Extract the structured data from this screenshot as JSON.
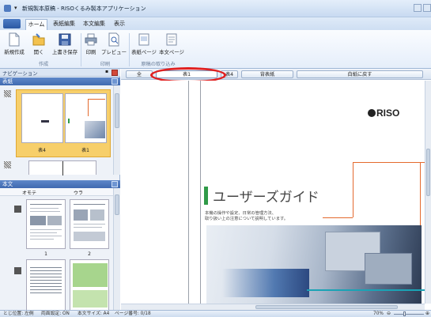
{
  "window": {
    "title": "新規製本原稿 - RISOくるみ製本アプリケーション"
  },
  "tabs": [
    "ホーム",
    "表紙編集",
    "本文編集",
    "表示"
  ],
  "ribbon": {
    "buttons": [
      "新規作成",
      "開く",
      "上書き保存",
      "印刷",
      "プレビュー",
      "表紙ページ",
      "本文ページ"
    ],
    "groups": [
      "作成",
      "印刷",
      "原稿の取り込み"
    ]
  },
  "nav": {
    "header": "ナビゲーション",
    "cover": {
      "header": "表紙",
      "thumb_labels": [
        "表4",
        "表1"
      ]
    },
    "body": {
      "header": "本文",
      "columns": [
        "オモテ",
        "ウラ"
      ],
      "page_numbers": [
        "1",
        "2"
      ]
    }
  },
  "doctabs": [
    "全",
    "表1",
    "表4",
    "背表紙",
    "白紙に戻す"
  ],
  "document": {
    "logo": "RISO",
    "title": "ユーザーズガイド",
    "desc": [
      "本機の操作や設定、日常の管理方法、",
      "取り扱い上の注意について説明しています。"
    ]
  },
  "status": {
    "binding": "とじ位置: 左側",
    "duplex": "両面設定: ON",
    "size": "本文サイズ: A4",
    "page": "ページ番号: 0/18",
    "zoom": "70%"
  },
  "colors": {
    "accent": "#3f69b0",
    "highlight": "#f7cf6a",
    "red_marker": "#e02020",
    "green_bar": "#2f9a48",
    "orange_line": "#e46a2e"
  }
}
